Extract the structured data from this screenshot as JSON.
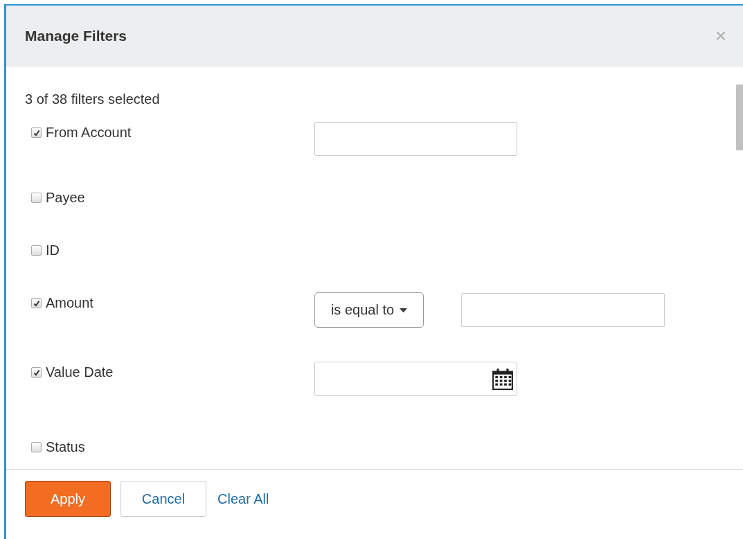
{
  "dialog": {
    "title": "Manage Filters",
    "close": "×"
  },
  "summary": "3 of 38 filters selected",
  "filters": [
    {
      "label": "From Account",
      "checked": true,
      "kind": "text"
    },
    {
      "label": "Payee",
      "checked": false,
      "kind": "none"
    },
    {
      "label": "ID",
      "checked": false,
      "kind": "none"
    },
    {
      "label": "Amount",
      "checked": true,
      "kind": "compare",
      "operator": "is equal to"
    },
    {
      "label": "Value Date",
      "checked": true,
      "kind": "date"
    },
    {
      "label": "Status",
      "checked": false,
      "kind": "none"
    }
  ],
  "buttons": [
    {
      "label": "Apply",
      "kind": "primary"
    },
    {
      "label": "Cancel",
      "kind": "secondary"
    },
    {
      "label": "Clear All",
      "kind": "link"
    }
  ]
}
